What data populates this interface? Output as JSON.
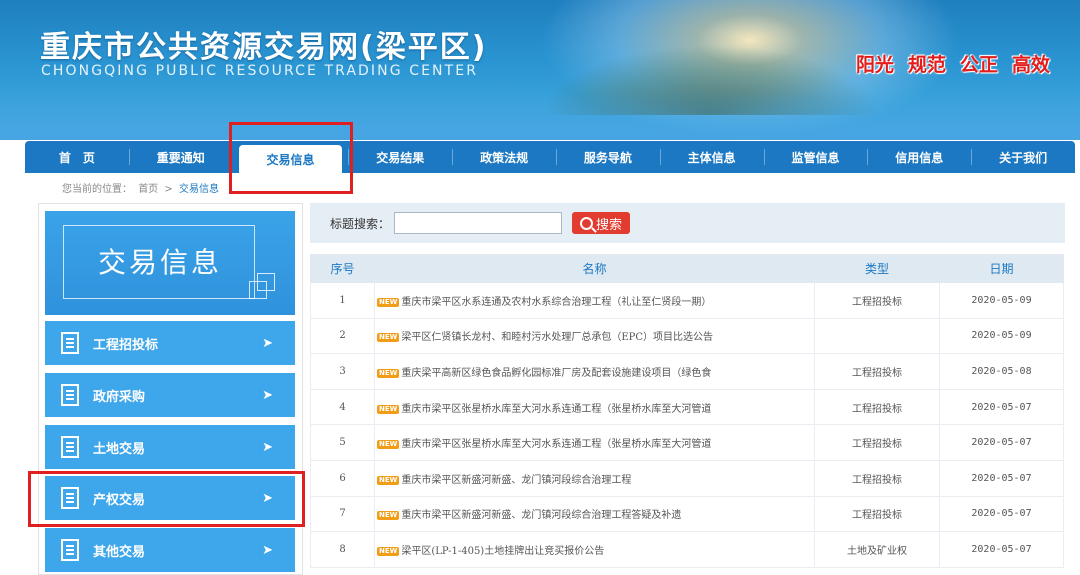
{
  "header": {
    "title": "重庆市公共资源交易网(梁平区)",
    "subtitle": "CHONGQING PUBLIC RESOURCE TRADING CENTER",
    "slogans": [
      "阳光",
      "规范",
      "公正",
      "高效"
    ]
  },
  "nav": {
    "items": [
      "首　页",
      "重要通知",
      "交易信息",
      "交易结果",
      "政策法规",
      "服务导航",
      "主体信息",
      "监管信息",
      "信用信息",
      "关于我们"
    ],
    "active_index": 2
  },
  "breadcrumb": {
    "prefix": "您当前的位置：",
    "home": "首页",
    "sep": ">",
    "current": "交易信息"
  },
  "sidebar": {
    "heading": "交易信息",
    "items": [
      "工程招投标",
      "政府采购",
      "土地交易",
      "产权交易",
      "其他交易"
    ],
    "arrow": "➤"
  },
  "search": {
    "label": "标题搜索：",
    "value": "",
    "button": "搜索"
  },
  "table": {
    "headers": [
      "序号",
      "名称",
      "类型",
      "日期"
    ],
    "badge": "NEW",
    "rows": [
      {
        "no": "1",
        "name": "重庆市梁平区水系连通及农村水系综合治理工程（礼让至仁贤段一期）",
        "type": "工程招投标",
        "date": "2020-05-09"
      },
      {
        "no": "2",
        "name": "梁平区仁贤镇长龙村、和睦村污水处理厂总承包（EPC）项目比选公告",
        "type": "",
        "date": "2020-05-09"
      },
      {
        "no": "3",
        "name": "重庆梁平高新区绿色食品孵化园标准厂房及配套设施建设项目（绿色食",
        "type": "工程招投标",
        "date": "2020-05-08"
      },
      {
        "no": "4",
        "name": "重庆市梁平区张星桥水库至大河水系连通工程（张星桥水库至大河管道",
        "type": "工程招投标",
        "date": "2020-05-07"
      },
      {
        "no": "5",
        "name": "重庆市梁平区张星桥水库至大河水系连通工程（张星桥水库至大河管道",
        "type": "工程招投标",
        "date": "2020-05-07"
      },
      {
        "no": "6",
        "name": "重庆市梁平区新盛河新盛、龙门镇河段综合治理工程",
        "type": "工程招投标",
        "date": "2020-05-07"
      },
      {
        "no": "7",
        "name": "重庆市梁平区新盛河新盛、龙门镇河段综合治理工程答疑及补遗",
        "type": "工程招投标",
        "date": "2020-05-07"
      },
      {
        "no": "8",
        "name": "梁平区(LP-1-405)土地挂牌出让竞买报价公告",
        "type": "土地及矿业权",
        "date": "2020-05-07"
      }
    ]
  }
}
